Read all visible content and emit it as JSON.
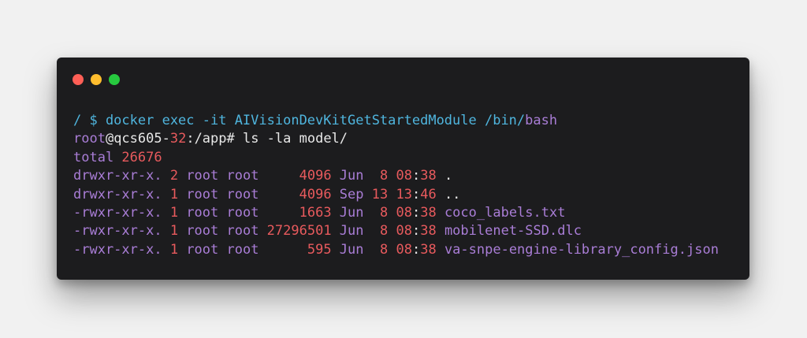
{
  "terminal": {
    "lines": [
      {
        "segments": [
          {
            "text": "/ $ docker exec -it AIVisionDevKitGetStartedModule /bin/",
            "color": "cyan"
          },
          {
            "text": "bash",
            "color": "purple"
          }
        ]
      },
      {
        "segments": [
          {
            "text": "root",
            "color": "purple"
          },
          {
            "text": "@qcs605-",
            "color": "white"
          },
          {
            "text": "32",
            "color": "red"
          },
          {
            "text": ":/app# ls -la model/",
            "color": "white"
          }
        ]
      },
      {
        "segments": [
          {
            "text": "total ",
            "color": "purple"
          },
          {
            "text": "26676",
            "color": "red"
          }
        ]
      },
      {
        "segments": [
          {
            "text": "drwxr-xr-x. ",
            "color": "purple"
          },
          {
            "text": "2",
            "color": "red"
          },
          {
            "text": " root root     ",
            "color": "purple"
          },
          {
            "text": "4096",
            "color": "red"
          },
          {
            "text": " Jun  ",
            "color": "purple"
          },
          {
            "text": "8",
            "color": "red"
          },
          {
            "text": " ",
            "color": "purple"
          },
          {
            "text": "08",
            "color": "red"
          },
          {
            "text": ":",
            "color": "white"
          },
          {
            "text": "38",
            "color": "red"
          },
          {
            "text": " .",
            "color": "white"
          }
        ]
      },
      {
        "segments": [
          {
            "text": "drwxr-xr-x. ",
            "color": "purple"
          },
          {
            "text": "1",
            "color": "red"
          },
          {
            "text": " root root     ",
            "color": "purple"
          },
          {
            "text": "4096",
            "color": "red"
          },
          {
            "text": " Sep ",
            "color": "purple"
          },
          {
            "text": "13",
            "color": "red"
          },
          {
            "text": " ",
            "color": "purple"
          },
          {
            "text": "13",
            "color": "red"
          },
          {
            "text": ":",
            "color": "white"
          },
          {
            "text": "46",
            "color": "red"
          },
          {
            "text": " ..",
            "color": "white"
          }
        ]
      },
      {
        "segments": [
          {
            "text": "-rwxr-xr-x. ",
            "color": "purple"
          },
          {
            "text": "1",
            "color": "red"
          },
          {
            "text": " root root     ",
            "color": "purple"
          },
          {
            "text": "1663",
            "color": "red"
          },
          {
            "text": " Jun  ",
            "color": "purple"
          },
          {
            "text": "8",
            "color": "red"
          },
          {
            "text": " ",
            "color": "purple"
          },
          {
            "text": "08",
            "color": "red"
          },
          {
            "text": ":",
            "color": "white"
          },
          {
            "text": "38",
            "color": "red"
          },
          {
            "text": " coco_labels.txt",
            "color": "purple"
          }
        ]
      },
      {
        "segments": [
          {
            "text": "-rwxr-xr-x. ",
            "color": "purple"
          },
          {
            "text": "1",
            "color": "red"
          },
          {
            "text": " root root ",
            "color": "purple"
          },
          {
            "text": "27296501",
            "color": "red"
          },
          {
            "text": " Jun  ",
            "color": "purple"
          },
          {
            "text": "8",
            "color": "red"
          },
          {
            "text": " ",
            "color": "purple"
          },
          {
            "text": "08",
            "color": "red"
          },
          {
            "text": ":",
            "color": "white"
          },
          {
            "text": "38",
            "color": "red"
          },
          {
            "text": " mobilenet-SSD.dlc",
            "color": "purple"
          }
        ]
      },
      {
        "segments": [
          {
            "text": "-rwxr-xr-x. ",
            "color": "purple"
          },
          {
            "text": "1",
            "color": "red"
          },
          {
            "text": " root root      ",
            "color": "purple"
          },
          {
            "text": "595",
            "color": "red"
          },
          {
            "text": " Jun  ",
            "color": "purple"
          },
          {
            "text": "8",
            "color": "red"
          },
          {
            "text": " ",
            "color": "purple"
          },
          {
            "text": "08",
            "color": "red"
          },
          {
            "text": ":",
            "color": "white"
          },
          {
            "text": "38",
            "color": "red"
          },
          {
            "text": " va-snpe-engine-library_config.json",
            "color": "purple"
          }
        ]
      }
    ]
  },
  "colors": {
    "cyan": "#4fb5de",
    "purple": "#a97dd6",
    "red": "#e85a5d",
    "white": "#e8e8e8",
    "background": "#1c1c1e"
  }
}
